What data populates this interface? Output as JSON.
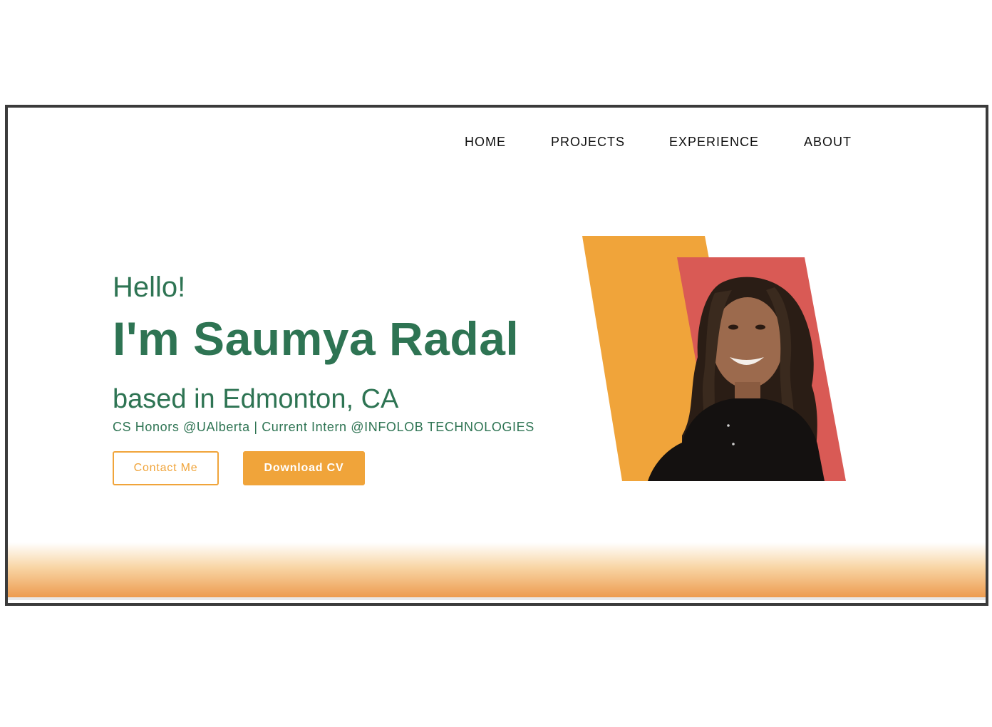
{
  "nav": {
    "items": [
      "HOME",
      "PROJECTS",
      "EXPERIENCE",
      "ABOUT"
    ]
  },
  "hero": {
    "greeting": "Hello!",
    "name": "I'm Saumya Radal",
    "location": "based in Edmonton, CA",
    "tagline": "CS Honors @UAlberta | Current Intern @INFOLOB TECHNOLOGIES",
    "contact_label": "Contact Me",
    "cv_label": "Download CV"
  },
  "colors": {
    "accent": "#f0a43a",
    "text_green": "#2e7453",
    "shape_red": "#d95a55"
  }
}
